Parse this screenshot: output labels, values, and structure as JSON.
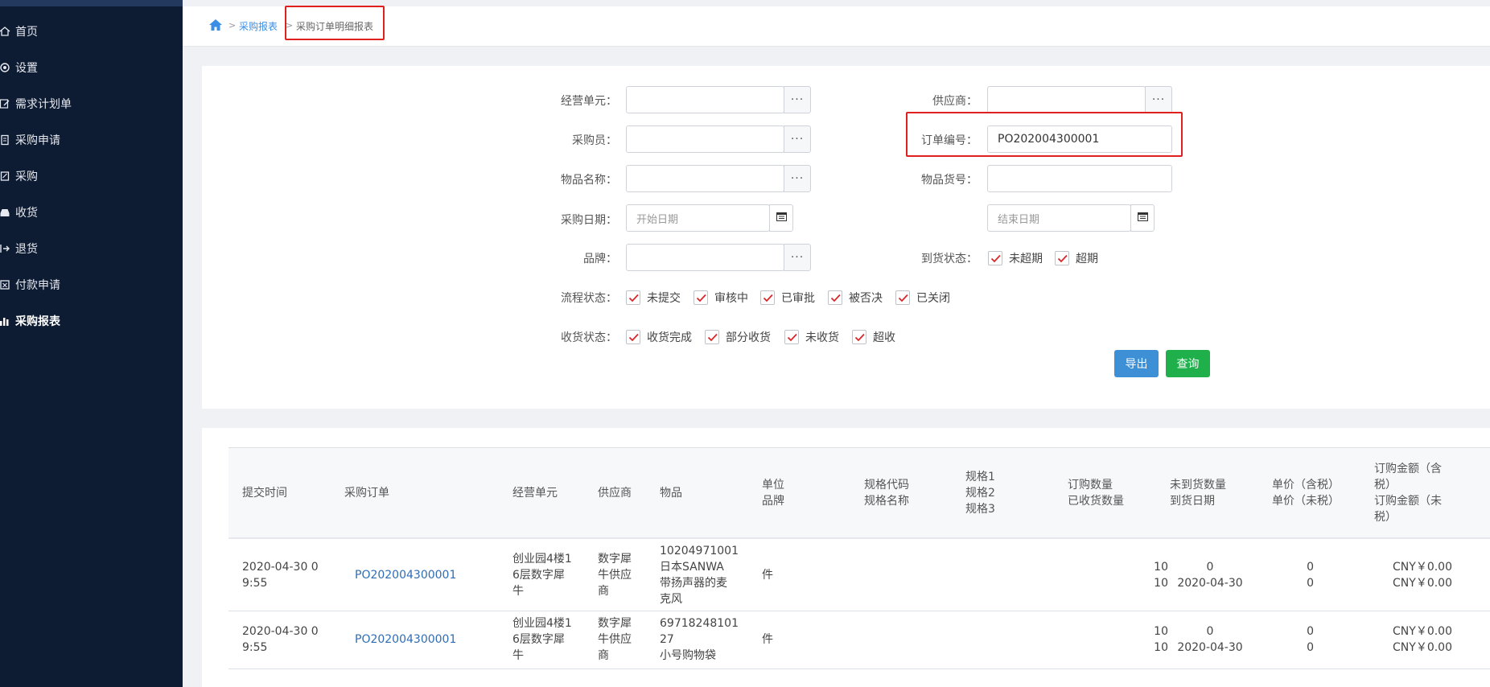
{
  "sidebar": {
    "items": [
      {
        "label": "首页",
        "icon": "home-icon"
      },
      {
        "label": "设置",
        "icon": "gear-icon"
      },
      {
        "label": "需求计划单",
        "icon": "edit-icon"
      },
      {
        "label": "采购申请",
        "icon": "document-icon"
      },
      {
        "label": "采购",
        "icon": "cart-icon"
      },
      {
        "label": "收货",
        "icon": "inbox-icon"
      },
      {
        "label": "退货",
        "icon": "return-icon"
      },
      {
        "label": "付款申请",
        "icon": "payment-icon"
      },
      {
        "label": "采购报表",
        "icon": "bar-chart-icon",
        "active": true
      }
    ]
  },
  "breadcrumb": {
    "home_icon": "home-icon",
    "sep": ">",
    "item1": "采购报表",
    "item2": "采购订单明细报表"
  },
  "filters": {
    "business_unit": {
      "label": "经营单元：",
      "value": ""
    },
    "supplier": {
      "label": "供应商：",
      "value": ""
    },
    "buyer": {
      "label": "采购员：",
      "value": ""
    },
    "order_no": {
      "label": "订单编号：",
      "value": "PO202004300001"
    },
    "item_name": {
      "label": "物品名称：",
      "value": ""
    },
    "item_code": {
      "label": "物品货号：",
      "value": ""
    },
    "purchase_date": {
      "label": "采购日期：",
      "start_placeholder": "开始日期",
      "end_placeholder": "结束日期"
    },
    "brand": {
      "label": "品牌：",
      "value": ""
    },
    "arrival_status": {
      "label": "到货状态：",
      "options": [
        "未超期",
        "超期"
      ]
    },
    "flow_status": {
      "label": "流程状态：",
      "options": [
        "未提交",
        "审核中",
        "已审批",
        "被否决",
        "已关闭"
      ]
    },
    "receipt_status": {
      "label": "收货状态：",
      "options": [
        "收货完成",
        "部分收货",
        "未收货",
        "超收"
      ]
    },
    "dots": "···"
  },
  "buttons": {
    "export": "导出",
    "query": "查询",
    "export_color": "#3d8fd6",
    "query_color": "#20b04b"
  },
  "table": {
    "headers": {
      "submit_time": "提交时间",
      "order": "采购订单",
      "business_unit": "经营单元",
      "supplier": "供应商",
      "item": "物品",
      "unit": "单位",
      "brand": "品牌",
      "spec_code": "规格代码",
      "spec_name": "规格名称",
      "spec1": "规格1",
      "spec2": "规格2",
      "spec3": "规格3",
      "order_qty": "订购数量",
      "received_qty": "已收货数量",
      "pending_qty": "未到货数量",
      "arrival_date": "到货日期",
      "price_tax": "单价（含税）",
      "price_notax": "单价（未税）",
      "amount_tax_1": "订购金额（含",
      "amount_tax_2": "税）",
      "amount_notax_1": "订购金额（未",
      "amount_notax_2": "税）"
    },
    "rows": [
      {
        "time1": "2020-04-30 0",
        "time2": "9:55",
        "order": "PO202004300001",
        "bu1": "创业园4楼1",
        "bu2": "6层数字犀",
        "bu3": "牛",
        "sup1": "数字犀",
        "sup2": "牛供应",
        "sup3": "商",
        "item1": "10204971001",
        "item2": "日本SANWA",
        "item3": "带扬声器的麦",
        "item4": "克风",
        "unit": "件",
        "order_qty": "10",
        "received_qty": "10",
        "pending_qty": "0",
        "arrival_date": "2020-04-30",
        "price_tax": "0",
        "price_notax": "0",
        "amount_tax": "CNY￥0.00",
        "amount_notax": "CNY￥0.00"
      },
      {
        "time1": "2020-04-30 0",
        "time2": "9:55",
        "order": "PO202004300001",
        "bu1": "创业园4楼1",
        "bu2": "6层数字犀",
        "bu3": "牛",
        "sup1": "数字犀",
        "sup2": "牛供应",
        "sup3": "商",
        "item1": "69718248101",
        "item2": "27",
        "item3": "小号购物袋",
        "unit": "件",
        "order_qty": "10",
        "received_qty": "10",
        "pending_qty": "0",
        "arrival_date": "2020-04-30",
        "price_tax": "0",
        "price_notax": "0",
        "amount_tax": "CNY￥0.00",
        "amount_notax": "CNY￥0.00"
      }
    ]
  },
  "colors": {
    "sidebar_bg": "#0d1b33",
    "highlight_box": "#e0201f",
    "link": "#2f6db3",
    "check": "#d9262b"
  }
}
